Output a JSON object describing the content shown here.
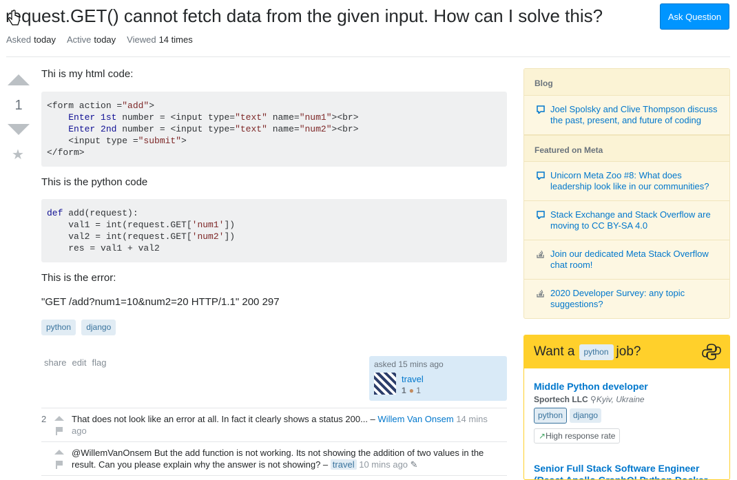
{
  "question": {
    "title": "request.GET() cannot fetch data from the given input. How can I solve this?",
    "asked_label": "Asked",
    "asked_value": "today",
    "active_label": "Active",
    "active_value": "today",
    "viewed_label": "Viewed",
    "viewed_value": "14 times",
    "vote_count": "1",
    "body": {
      "p1": "Thi is my html code:",
      "p2": "This is the python code",
      "p3": "This is the error:",
      "p4": "\"GET /add?num1=10&num2=20 HTTP/1.1\" 200 297"
    },
    "tags": [
      "python",
      "django"
    ],
    "menu": {
      "share": "share",
      "edit": "edit",
      "flag": "flag"
    },
    "owner": {
      "asked": "asked 15 mins ago",
      "name": "travel",
      "rep": "1",
      "bronze": "1"
    }
  },
  "ask_button": "Ask Question",
  "code_html": [
    [
      "<form action =",
      "\"add\"",
      ">"
    ],
    [
      "    ",
      "Enter 1st",
      " number = <input type=",
      "\"text\"",
      " name=",
      "\"num1\"",
      "><br>"
    ],
    [
      "    ",
      "Enter 2nd",
      " number = <input type=",
      "\"text\"",
      " name=",
      "\"num2\"",
      "><br>"
    ],
    [
      "    <input type =",
      "\"submit\"",
      ">"
    ],
    [
      "</form>"
    ]
  ],
  "code_py": [
    [
      "def",
      " add(request):"
    ],
    [
      "    val1 = int(request.GET[",
      "'num1'",
      "])"
    ],
    [
      "    val2 = int(request.GET[",
      "'num2'",
      "])"
    ],
    [
      "    res = val1 + val2"
    ]
  ],
  "comments": [
    {
      "score": "2",
      "text": "That does not look like an error at all. In fact it clearly shows a status 200... –",
      "user": "Willem Van Onsem",
      "date": "14 mins ago"
    },
    {
      "score": "",
      "text": "@WillemVanOnsem But the add function is not working. Its not showing the addition of two values in the result. Can you please explain why the answer is not showing? –",
      "user": "travel",
      "date": "10 mins ago"
    }
  ],
  "sidebar": {
    "blog_header": "Blog",
    "blog_items": [
      "Joel Spolsky and Clive Thompson discuss the past, present, and future of coding"
    ],
    "meta_header": "Featured on Meta",
    "meta_items": [
      "Unicorn Meta Zoo #8: What does leadership look like in our communities?",
      "Stack Exchange and Stack Overflow are moving to CC BY-SA 4.0",
      "Join our dedicated Meta Stack Overflow chat room!",
      "2020 Developer Survey: any topic suggestions?"
    ]
  },
  "jobs": {
    "head_before": "Want a",
    "head_tag": "python",
    "head_after": "job?",
    "job1": {
      "title": "Middle Python developer",
      "company": "Sportech LLC",
      "location": "Kyiv, Ukraine",
      "tags": [
        "python",
        "django"
      ],
      "badge": "High response rate"
    },
    "job2": {
      "title": "Senior Full Stack Software Engineer (React Apollo GraphQl Python Docker"
    }
  },
  "colors": {
    "accent": "#0095ff",
    "link": "#0077cc",
    "tag_bg": "#e1ecf4",
    "jobs_yellow": "#ffd02b"
  }
}
